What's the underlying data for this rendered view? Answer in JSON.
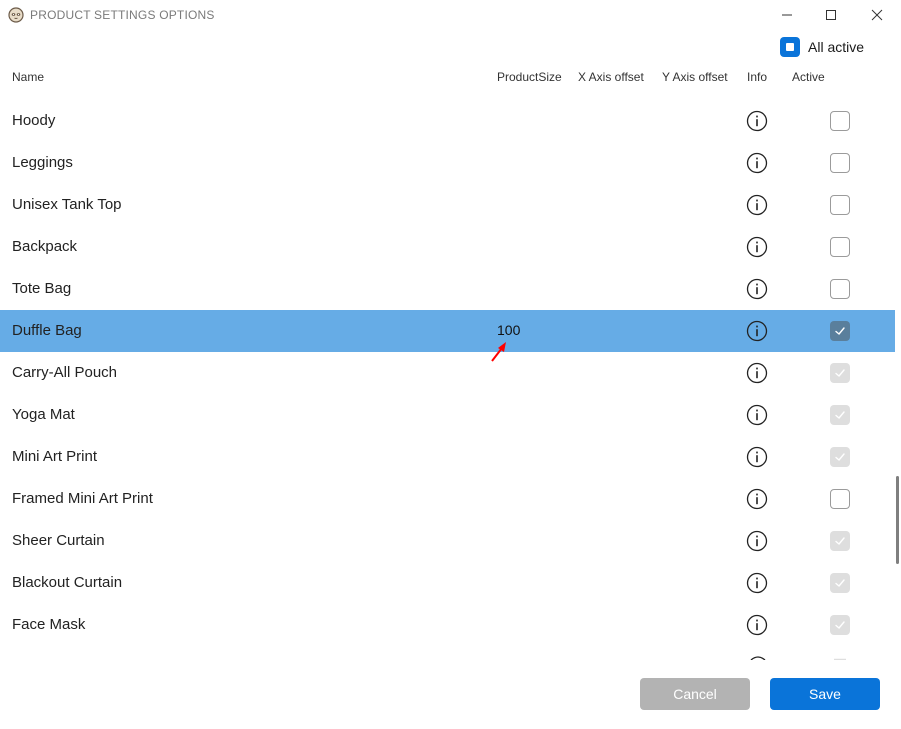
{
  "window": {
    "title": "PRODUCT SETTINGS OPTIONS",
    "app_icon": "sloth-face-icon",
    "controls": [
      "minimize-icon",
      "maximize-icon",
      "close-icon"
    ]
  },
  "all_active": {
    "label": "All active",
    "state": "indeterminate"
  },
  "columns": {
    "name": "Name",
    "product_size": "ProductSize",
    "x_offset": "X Axis offset",
    "y_offset": "Y Axis offset",
    "info": "Info",
    "active": "Active"
  },
  "rows": [
    {
      "name": "Hoody",
      "product_size": "",
      "active": "unchecked",
      "selected": false
    },
    {
      "name": "Leggings",
      "product_size": "",
      "active": "unchecked",
      "selected": false
    },
    {
      "name": "Unisex Tank Top",
      "product_size": "",
      "active": "unchecked",
      "selected": false
    },
    {
      "name": "Backpack",
      "product_size": "",
      "active": "unchecked",
      "selected": false
    },
    {
      "name": "Tote Bag",
      "product_size": "",
      "active": "unchecked",
      "selected": false
    },
    {
      "name": "Duffle Bag",
      "product_size": "100",
      "active": "checked-disabled",
      "selected": true
    },
    {
      "name": "Carry-All Pouch",
      "product_size": "",
      "active": "checked-disabled",
      "selected": false
    },
    {
      "name": "Yoga Mat",
      "product_size": "",
      "active": "checked-disabled",
      "selected": false
    },
    {
      "name": "Mini Art Print",
      "product_size": "",
      "active": "checked-disabled",
      "selected": false
    },
    {
      "name": "Framed Mini Art Print",
      "product_size": "",
      "active": "unchecked",
      "selected": false
    },
    {
      "name": "Sheer Curtain",
      "product_size": "",
      "active": "checked-disabled",
      "selected": false
    },
    {
      "name": "Blackout Curtain",
      "product_size": "",
      "active": "checked-disabled",
      "selected": false
    },
    {
      "name": "Face Mask",
      "product_size": "",
      "active": "checked-disabled",
      "selected": false
    }
  ],
  "buttons": {
    "cancel": "Cancel",
    "save": "Save"
  },
  "colors": {
    "accent": "#0a74d9",
    "selected_row": "#66ace6",
    "cancel_button": "#b3b3b3",
    "annotation_arrow": "#ff0000"
  }
}
